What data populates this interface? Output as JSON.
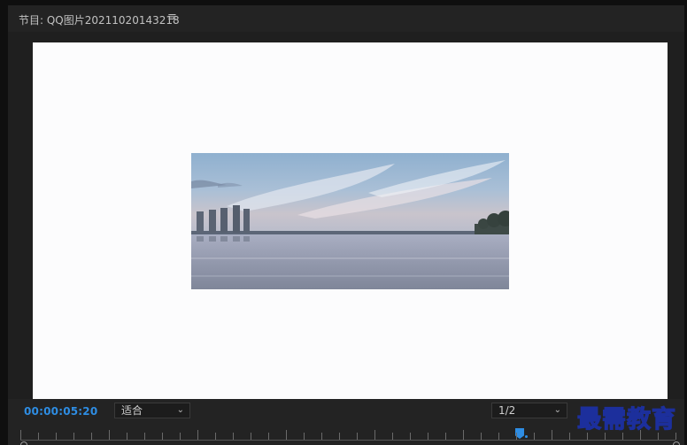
{
  "panel": {
    "title": "节目: QQ图片20211020143218",
    "menu_icon": "≡"
  },
  "playback": {
    "timecode": "00:00:05:20"
  },
  "zoom_select": {
    "value": "适合",
    "chevron": "⌄"
  },
  "resolution_select": {
    "value": "1/2",
    "chevron": "⌄"
  },
  "watermark": {
    "text": "最需教育"
  },
  "colors": {
    "accent": "#2e8de3",
    "viewer_bg": "#fcfcfd",
    "panel_bg": "#232323"
  }
}
